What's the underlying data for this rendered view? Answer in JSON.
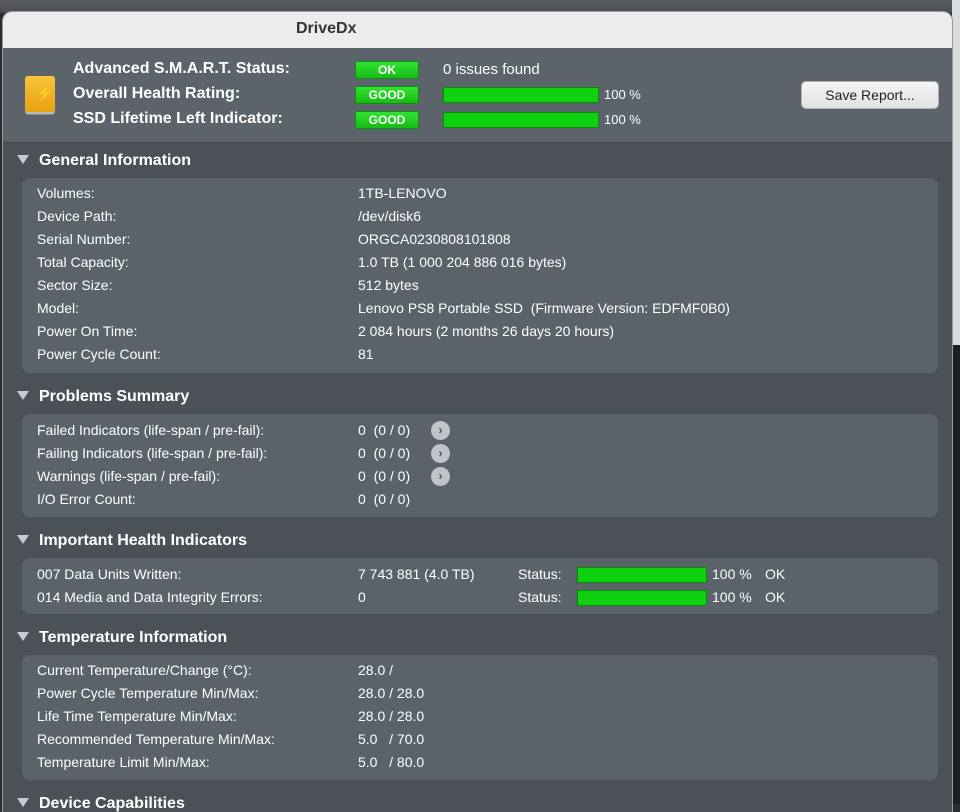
{
  "window": {
    "title": "DriveDx"
  },
  "header": {
    "smart_status_label": "Advanced S.M.A.R.T. Status:",
    "smart_status_badge": "OK",
    "issues_text": "0 issues found",
    "health_label": "Overall Health Rating:",
    "health_badge": "GOOD",
    "health_percent": "100 %",
    "health_level": 1.0,
    "lifetime_label": "SSD Lifetime Left Indicator:",
    "lifetime_badge": "GOOD",
    "lifetime_percent": "100 %",
    "lifetime_level": 1.0,
    "save_report_label": "Save Report..."
  },
  "general": {
    "title": "General Information",
    "rows": [
      {
        "k": "Volumes:",
        "v": "1TB-LENOVO"
      },
      {
        "k": "Device Path:",
        "v": "/dev/disk6"
      },
      {
        "k": "Serial Number:",
        "v": "ORGCA0230808101808"
      },
      {
        "k": "Total Capacity:",
        "v": "1.0 TB (1 000 204 886 016 bytes)"
      },
      {
        "k": "Sector Size:",
        "v": "512 bytes"
      },
      {
        "k": "Model:",
        "v": "Lenovo PS8 Portable SSD  (Firmware Version: EDFMF0B0)"
      },
      {
        "k": "Power On Time:",
        "v": "2 084 hours (2 months 26 days 20 hours)"
      },
      {
        "k": "Power Cycle Count:",
        "v": "81"
      }
    ]
  },
  "problems": {
    "title": "Problems Summary",
    "rows": [
      {
        "k": "Failed Indicators (life-span / pre-fail):",
        "v": "0  (0 / 0)"
      },
      {
        "k": "Failing Indicators (life-span / pre-fail):",
        "v": "0  (0 / 0)"
      },
      {
        "k": "Warnings (life-span / pre-fail):",
        "v": "0  (0 / 0)"
      },
      {
        "k": "I/O Error Count:",
        "v": "0  (0 / 0)"
      }
    ],
    "arrow_glyph": "›"
  },
  "health": {
    "title": "Important Health Indicators",
    "rows": [
      {
        "k": "007  Data Units Written:",
        "v": "7 743 881 (4.0 TB)",
        "status_label": "Status:",
        "pct": "100 %",
        "ok": "OK",
        "level": 1.0
      },
      {
        "k": "014  Media and Data Integrity Errors:",
        "v": "0",
        "status_label": "Status:",
        "pct": "100 %",
        "ok": "OK",
        "level": 1.0
      }
    ]
  },
  "temperature": {
    "title": "Temperature Information",
    "rows": [
      {
        "k": "Current Temperature/Change (°C):",
        "v": "28.0 /"
      },
      {
        "k": "Power Cycle Temperature Min/Max:",
        "v": "28.0 / 28.0"
      },
      {
        "k": "Life Time Temperature Min/Max:",
        "v": "28.0 / 28.0"
      },
      {
        "k": "Recommended Temperature Min/Max:",
        "v": "5.0   / 70.0"
      },
      {
        "k": "Temperature Limit Min/Max:",
        "v": "5.0   / 80.0"
      }
    ]
  },
  "capabilities": {
    "title": "Device Capabilities"
  },
  "colors": {
    "bar_green": "#0fd10f",
    "badge_green": "#22cc22",
    "panel_bg": "#5c626a",
    "window_bg": "#4c5158"
  }
}
